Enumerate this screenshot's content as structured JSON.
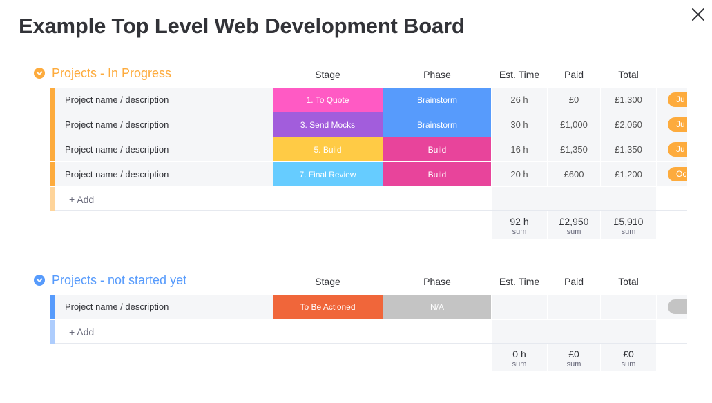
{
  "board": {
    "title": "Example Top Level Web Development Board"
  },
  "columns": {
    "stage": "Stage",
    "phase": "Phase",
    "est_time": "Est. Time",
    "paid": "Paid",
    "total": "Total"
  },
  "groups": [
    {
      "title": "Projects - In Progress",
      "color": "#fdab3d",
      "rows": [
        {
          "name": "Project name / description",
          "stage": "1. To Quote",
          "stage_color": "#ff5ac4",
          "phase": "Brainstorm",
          "phase_color": "#579bfc",
          "est_time": "26 h",
          "paid": "£0",
          "total": "£1,300",
          "tag": "Ju",
          "tag_color": "#fdab3d"
        },
        {
          "name": "Project name / description",
          "stage": "3. Send Mocks",
          "stage_color": "#a25ddc",
          "phase": "Brainstorm",
          "phase_color": "#579bfc",
          "est_time": "30 h",
          "paid": "£1,000",
          "total": "£2,060",
          "tag": "Ju",
          "tag_color": "#fdab3d"
        },
        {
          "name": "Project name / description",
          "stage": "5. Build",
          "stage_color": "#ffcb45",
          "phase": "Build",
          "phase_color": "#e8449b",
          "est_time": "16 h",
          "paid": "£1,350",
          "total": "£1,350",
          "tag": "Ju",
          "tag_color": "#fdab3d"
        },
        {
          "name": "Project name / description",
          "stage": "7. Final Review",
          "stage_color": "#66ccff",
          "phase": "Build",
          "phase_color": "#e8449b",
          "est_time": "20 h",
          "paid": "£600",
          "total": "£1,200",
          "tag": "Oc",
          "tag_color": "#fdab3d"
        }
      ],
      "add_label": "+ Add",
      "sums": {
        "est_time": "92 h",
        "paid": "£2,950",
        "total": "£5,910",
        "label": "sum"
      }
    },
    {
      "title": "Projects - not started yet",
      "color": "#579bfc",
      "rows": [
        {
          "name": "Project name / description",
          "stage": "To Be Actioned",
          "stage_color": "#f0663a",
          "phase": "N/A",
          "phase_color": "#c4c4c4",
          "est_time": "",
          "paid": "",
          "total": "",
          "tag": "",
          "tag_color": "#c4c4c4"
        }
      ],
      "add_label": "+ Add",
      "sums": {
        "est_time": "0 h",
        "paid": "£0",
        "total": "£0",
        "label": "sum"
      }
    }
  ]
}
